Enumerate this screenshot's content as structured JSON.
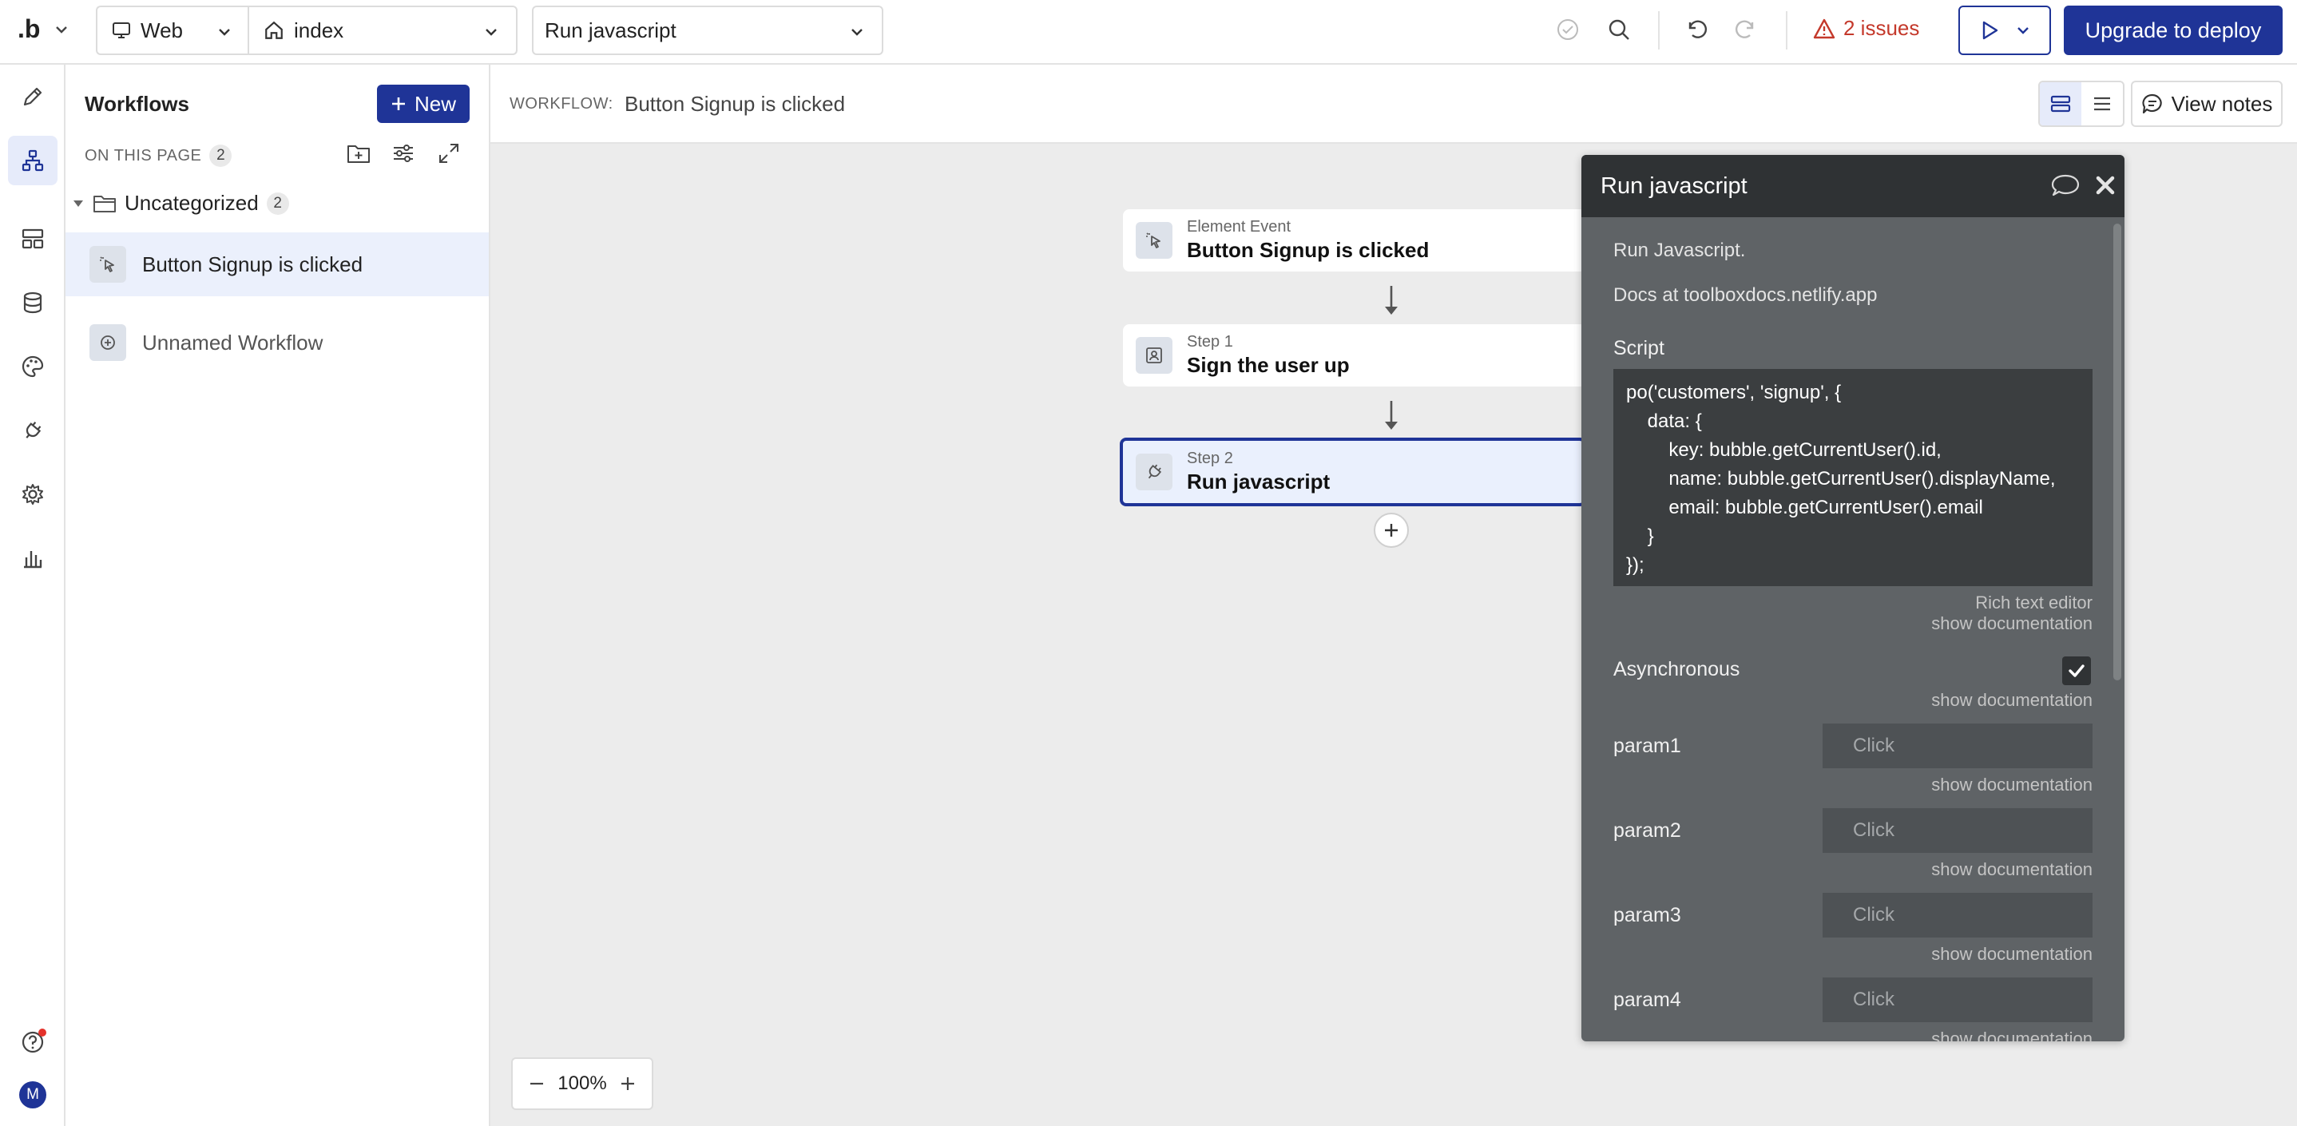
{
  "topbar": {
    "logo": ".b",
    "platform": "Web",
    "page": "index",
    "action": "Run javascript",
    "issues": "2 issues",
    "upgrade_label": "Upgrade to deploy"
  },
  "sidebar": {
    "title": "Workflows",
    "new_label": "New",
    "on_this_page": "ON THIS PAGE",
    "on_this_page_count": "2",
    "folder": "Uncategorized",
    "folder_count": "2",
    "items": [
      {
        "label": "Button Signup is clicked"
      },
      {
        "label": "Unnamed Workflow"
      }
    ]
  },
  "rail": {
    "avatar": "M"
  },
  "canvas": {
    "workflow_label": "WORKFLOW:",
    "workflow_name": "Button Signup is clicked",
    "view_notes": "View notes",
    "zoom": "100%",
    "nodes": [
      {
        "small": "Element Event",
        "big": "Button Signup is clicked"
      },
      {
        "small": "Step 1",
        "big": "Sign the user up"
      },
      {
        "small": "Step 2",
        "big": "Run javascript"
      }
    ]
  },
  "panel": {
    "title": "Run javascript",
    "desc": "Run Javascript.",
    "docs": "Docs at toolboxdocs.netlify.app",
    "script_label": "Script",
    "script": "po('customers', 'signup', {\n    data: {\n        key: bubble.getCurrentUser().id,\n        name: bubble.getCurrentUser().displayName,\n        email: bubble.getCurrentUser().email\n    }\n});",
    "rich_text": "Rich text editor",
    "show_doc": "show documentation",
    "async_label": "Asynchronous",
    "params": [
      {
        "name": "param1",
        "placeholder": "Click"
      },
      {
        "name": "param2",
        "placeholder": "Click"
      },
      {
        "name": "param3",
        "placeholder": "Click"
      },
      {
        "name": "param4",
        "placeholder": "Click"
      }
    ]
  },
  "colors": {
    "primary": "#1f3497",
    "issue": "#c4392b",
    "panel_bg": "#5f6366",
    "panel_head": "#2f3234"
  }
}
